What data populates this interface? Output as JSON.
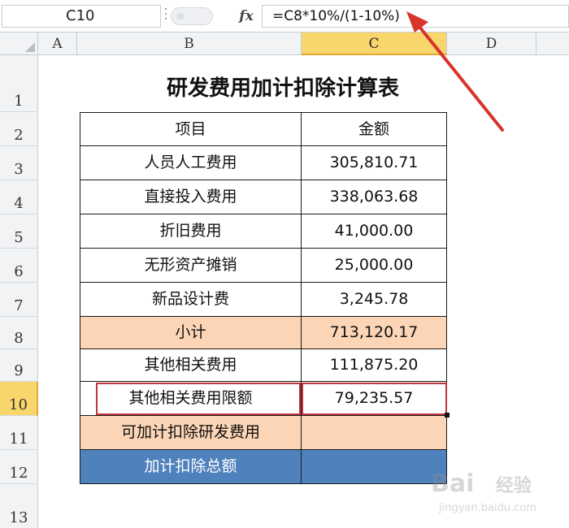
{
  "formula_bar": {
    "name_box": "C10",
    "fx_label": "fx",
    "formula": "=C8*10%/(1-10%)"
  },
  "columns": [
    "A",
    "B",
    "C",
    "D"
  ],
  "selected_column": "C",
  "rows": [
    "1",
    "2",
    "3",
    "4",
    "5",
    "6",
    "7",
    "8",
    "9",
    "10",
    "11",
    "12",
    "13"
  ],
  "selected_row": "10",
  "sheet": {
    "title": "研发费用加计扣除计算表",
    "header": {
      "item": "项目",
      "amount": "金额"
    },
    "items": [
      {
        "label": "人员人工费用",
        "value": "305,810.71",
        "style": "plain"
      },
      {
        "label": "直接投入费用",
        "value": "338,063.68",
        "style": "plain"
      },
      {
        "label": "折旧费用",
        "value": "41,000.00",
        "style": "plain"
      },
      {
        "label": "无形资产摊销",
        "value": "25,000.00",
        "style": "plain"
      },
      {
        "label": "新品设计费",
        "value": "3,245.78",
        "style": "plain"
      },
      {
        "label": "小计",
        "value": "713,120.17",
        "style": "peach"
      },
      {
        "label": "其他相关费用",
        "value": "111,875.20",
        "style": "plain"
      },
      {
        "label": "其他相关费用限额",
        "value": "79,235.57",
        "style": "highlight"
      },
      {
        "label": "可加计扣除研发费用",
        "value": "",
        "style": "peach"
      },
      {
        "label": "加计扣除总额",
        "value": "",
        "style": "blue"
      }
    ]
  },
  "colors": {
    "peach": "#fbd5b5",
    "blue": "#4f81bd",
    "highlight_border": "#c0343b",
    "arrow": "#d9342b",
    "selected_header": "#f9d66b"
  },
  "watermark": {
    "brand": "Bai",
    "suffix": "经验",
    "url": "jingyan.baidu.com"
  }
}
